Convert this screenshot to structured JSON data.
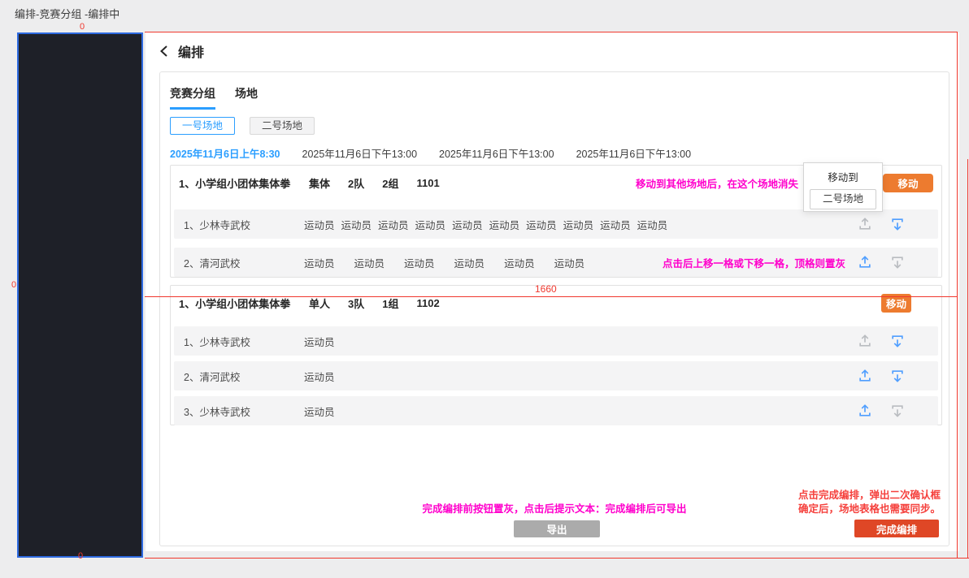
{
  "colors": {
    "accent_blue": "#2b9eff",
    "icon_blue": "#4f9eff",
    "icon_gray": "#b9bcc0",
    "magenta_note": "#ff00cc",
    "red_note": "#f5413d",
    "redline": "#f0382e",
    "orange_move_button": "#ed7b2f",
    "finish_button": "#df4726",
    "export_disabled_button": "#ababab",
    "sidebar_fill": "#1e2028",
    "sidebar_border": "#2e6ae0"
  },
  "page": {
    "breadcrumb": "编排-竞赛分组 -编排中",
    "title": "编排"
  },
  "redlines": {
    "marker_top": "0",
    "marker_left": "0",
    "marker_bottom": "0",
    "width_label": "1660"
  },
  "tabs": [
    {
      "label": "竞赛分组",
      "active": true
    },
    {
      "label": "场地",
      "active": false
    }
  ],
  "venues": [
    {
      "label": "一号场地",
      "active": true
    },
    {
      "label": "二号场地",
      "active": false
    }
  ],
  "dates": [
    "2025年11月6日上午8:30",
    "2025年11月6日下午13:00",
    "2025年11月6日下午13:00",
    "2025年11月6日下午13:00"
  ],
  "popup": {
    "title": "移动到",
    "option": "二号场地"
  },
  "groups": [
    {
      "title": "1、小学组小团体集体拳",
      "meta": [
        "集体",
        "2队",
        "2组",
        "1101"
      ],
      "note": "移动到其他场地后，在这个场地消失",
      "move_label": "移动",
      "teams": [
        {
          "name": "1、少林寺武校",
          "athletes": [
            "运动员",
            "运动员",
            "运动员",
            "运动员",
            "运动员",
            "运动员",
            "运动员",
            "运动员",
            "运动员",
            "运动员"
          ],
          "up_enabled": false,
          "down_enabled": true
        },
        {
          "name": "2、清河武校",
          "athletes": [
            "运动员",
            "运动员",
            "运动员",
            "运动员",
            "运动员",
            "运动员"
          ],
          "note": "点击后上移一格或下移一格，顶格则置灰",
          "up_enabled": true,
          "down_enabled": false
        }
      ]
    },
    {
      "title": "1、小学组小团体集体拳",
      "meta": [
        "单人",
        "3队",
        "1组",
        "1102"
      ],
      "move_label": "移动",
      "teams": [
        {
          "name": "1、少林寺武校",
          "athletes": [
            "运动员"
          ],
          "up_enabled": false,
          "down_enabled": true
        },
        {
          "name": "2、清河武校",
          "athletes": [
            "运动员"
          ],
          "up_enabled": true,
          "down_enabled": true
        },
        {
          "name": "3、少林寺武校",
          "athletes": [
            "运动员"
          ],
          "up_enabled": true,
          "down_enabled": false
        }
      ]
    }
  ],
  "footer": {
    "export_note": "完成编排前按钮置灰，点击后提示文本：完成编排后可导出",
    "export_label": "导出",
    "finish_note_line1": "点击完成编排，弹出二次确认框",
    "finish_note_line2": "确定后，场地表格也需要同步。",
    "finish_label": "完成编排"
  }
}
